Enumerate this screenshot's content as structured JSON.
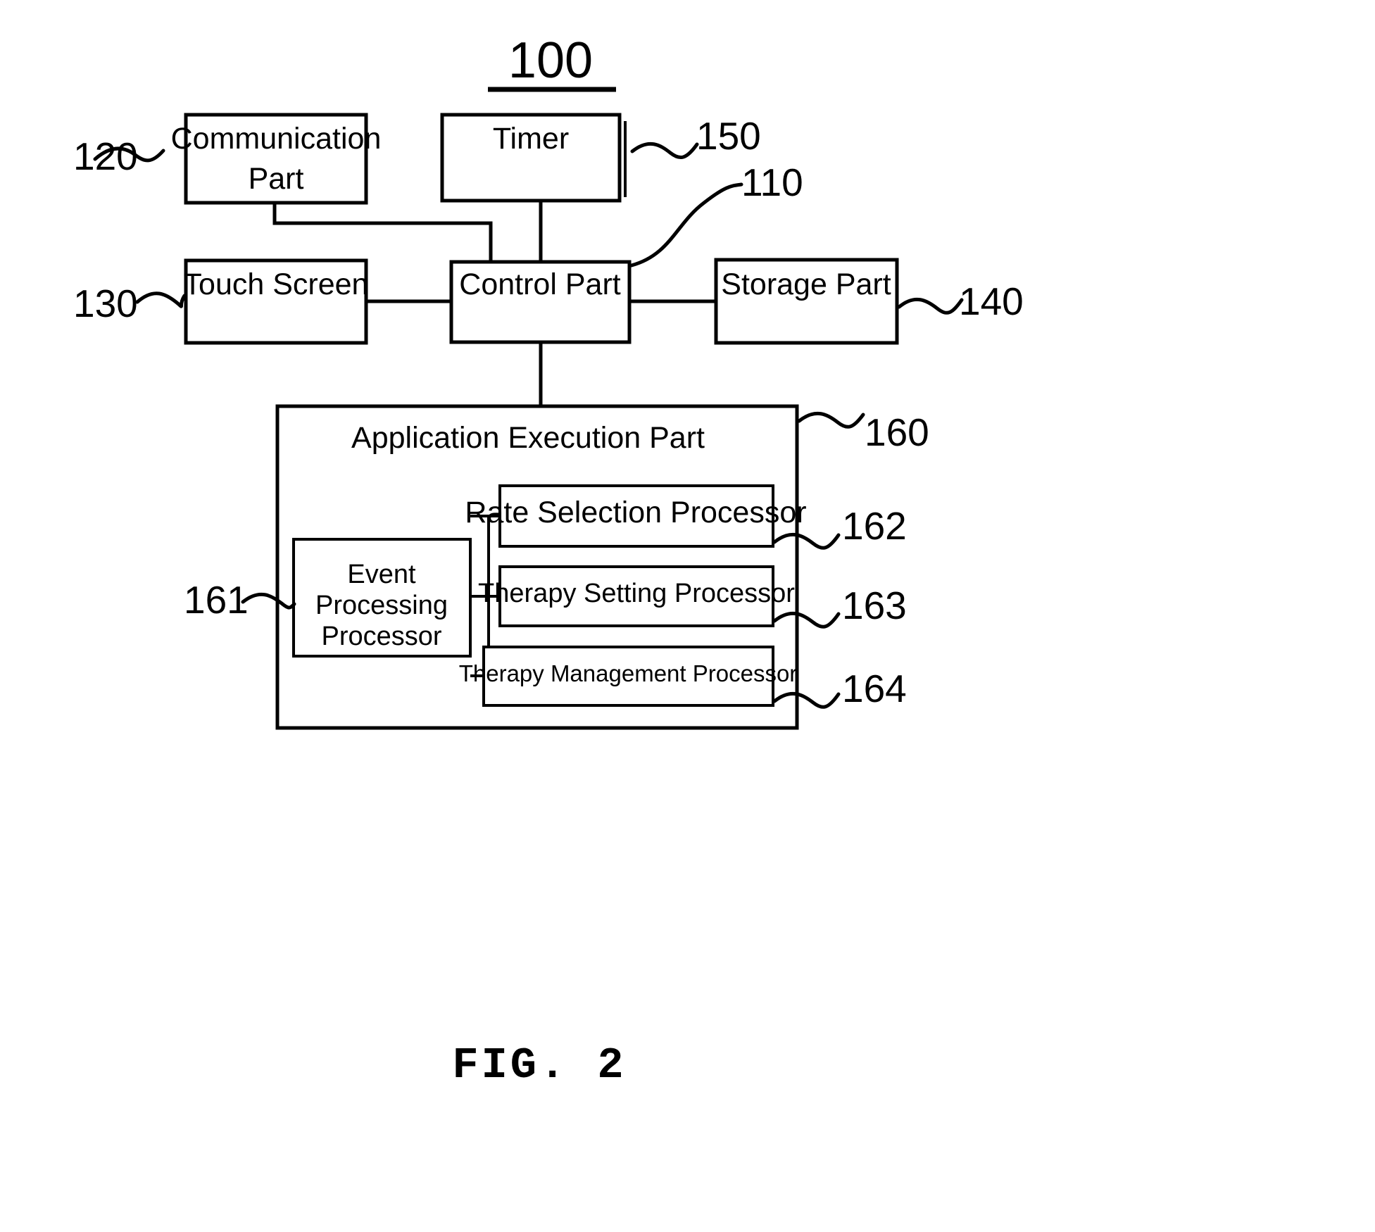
{
  "figure": {
    "system_number": "100",
    "caption": "FIG. 2",
    "line_color": "#000000",
    "background_color": "#ffffff"
  },
  "blocks": {
    "communication_part": {
      "label_line1": "Communication",
      "label_line2": "Part",
      "ref": "120"
    },
    "timer": {
      "label": "Timer",
      "ref": "150"
    },
    "touch_screen": {
      "label": "Touch Screen",
      "ref": "130"
    },
    "control_part": {
      "label": "Control Part",
      "ref": "110"
    },
    "storage_part": {
      "label": "Storage Part",
      "ref": "140"
    },
    "application_execution_part": {
      "label": "Application Execution Part",
      "ref": "160"
    },
    "event_processing_processor": {
      "label_line1": "Event",
      "label_line2": "Processing",
      "label_line3": "Processor",
      "ref": "161"
    },
    "rate_selection_processor": {
      "label": "Rate Selection Processor",
      "ref": "162"
    },
    "therapy_setting_processor": {
      "label": "Therapy Setting Processor",
      "ref": "163"
    },
    "therapy_management_processor": {
      "label": "Therapy Management Processor",
      "ref": "164"
    }
  }
}
